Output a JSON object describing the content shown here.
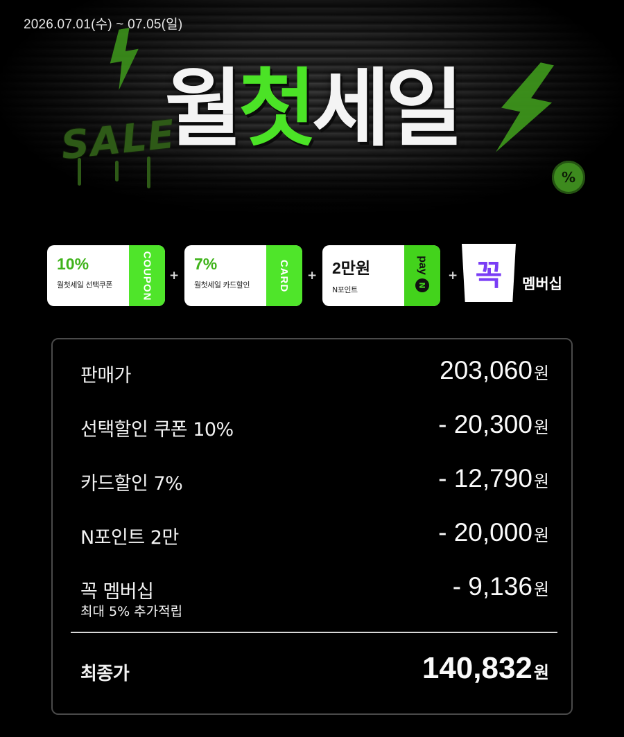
{
  "header": {
    "date_range": "2026.07.01(수) ~ 07.05(일)",
    "title_part1": "월",
    "title_highlight": "첫",
    "title_part2": "세일",
    "graffiti_text": "SALE",
    "percent_badge": "%"
  },
  "benefits": {
    "coupon": {
      "value": "10%",
      "desc": "월첫세일 선택쿠폰",
      "tab": "COUPON"
    },
    "card": {
      "value": "7%",
      "desc": "월첫세일 카드할인",
      "tab": "CARD"
    },
    "npoint": {
      "value": "2만원",
      "desc": "N포인트",
      "tab": "pay",
      "tab_mark": "N"
    },
    "membership": {
      "logo": "꼭",
      "label": "멤버십"
    },
    "plus": "+"
  },
  "price": {
    "unit": "원",
    "rows": [
      {
        "label": "판매가",
        "value": "203,060"
      },
      {
        "label": "선택할인 쿠폰 10%",
        "value": "- 20,300"
      },
      {
        "label": "카드할인 7%",
        "value": "- 12,790"
      },
      {
        "label": "N포인트 2만",
        "value": "- 20,000"
      },
      {
        "label": "꼭 멤버십",
        "sub": "최대 5% 추가적립",
        "value": "- 9,136"
      }
    ],
    "final": {
      "label": "최종가",
      "value": "140,832"
    }
  },
  "colors": {
    "accent_green": "#4be326",
    "membership_purple": "#7a3df5",
    "background": "#000000"
  },
  "icons": [
    "lightning-bolt-icon",
    "percent-badge-icon",
    "npay-logo-icon",
    "membership-logo-icon"
  ]
}
